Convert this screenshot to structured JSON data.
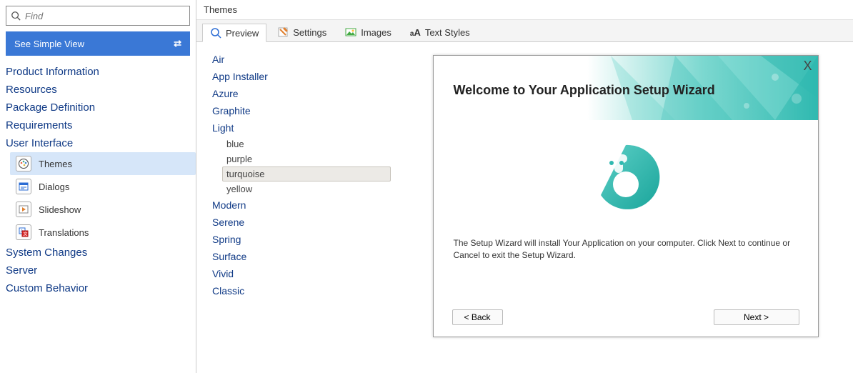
{
  "sidebar": {
    "search_placeholder": "Find",
    "simple_view": "See Simple View",
    "sections": [
      "Product Information",
      "Resources",
      "Package Definition",
      "Requirements",
      "User Interface",
      "System Changes",
      "Server",
      "Custom Behavior"
    ],
    "ui_subitems": [
      {
        "label": "Themes",
        "icon": "palette-icon"
      },
      {
        "label": "Dialogs",
        "icon": "dialog-icon"
      },
      {
        "label": "Slideshow",
        "icon": "slideshow-icon"
      },
      {
        "label": "Translations",
        "icon": "translate-icon"
      }
    ],
    "selected_subitem": 0
  },
  "main": {
    "title": "Themes",
    "tabs": [
      {
        "label": "Preview",
        "icon": "preview-icon"
      },
      {
        "label": "Settings",
        "icon": "settings-icon"
      },
      {
        "label": "Images",
        "icon": "images-icon"
      },
      {
        "label": "Text Styles",
        "icon": "text-styles-icon"
      }
    ],
    "active_tab": 0,
    "themes": [
      {
        "name": "Air"
      },
      {
        "name": "App Installer"
      },
      {
        "name": "Azure"
      },
      {
        "name": "Graphite"
      },
      {
        "name": "Light",
        "variants": [
          "blue",
          "purple",
          "turquoise",
          "yellow"
        ],
        "selected_variant": "turquoise"
      },
      {
        "name": "Modern"
      },
      {
        "name": "Serene"
      },
      {
        "name": "Spring"
      },
      {
        "name": "Surface"
      },
      {
        "name": "Vivid"
      },
      {
        "name": "Classic"
      }
    ]
  },
  "wizard": {
    "title": "Welcome to Your Application Setup Wizard",
    "body_text": "The Setup Wizard will install Your Application on your computer. Click Next to continue or Cancel to exit the Setup Wizard.",
    "back_label": "< Back",
    "next_label": "Next >",
    "accent": "#2fb9b0"
  }
}
